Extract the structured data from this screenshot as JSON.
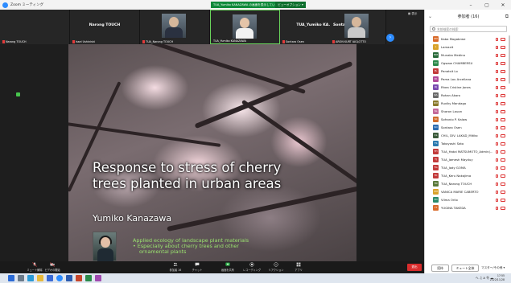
{
  "window": {
    "app_title": "Zoom ミーティング",
    "share_banner": "TUA_Yumiko KANAZAWA の画面を表示しています",
    "view_options_label": "ビューオプション ▾",
    "minimize": "–",
    "maximize": "▢",
    "close": "✕"
  },
  "video_strip": {
    "gallery_label": "▦ 表示",
    "next_icon": "›",
    "tiles": [
      {
        "center_name": "",
        "bottom_name": "Narong TOUCH",
        "photo": false
      },
      {
        "center_name": "Narong TOUCH",
        "bottom_name": "Issei Ushinishi",
        "photo": false
      },
      {
        "center_name": "",
        "bottom_name": "TUA_Narong TOUCH",
        "photo": true
      },
      {
        "center_name": "",
        "bottom_name": "TUA_Yumiko KANAZAWA",
        "photo": true
      },
      {
        "center_name": "TUA_Yumiko KA...",
        "bottom_name": "Sontaro Osen",
        "photo": false
      },
      {
        "center_name": "Sontaro Osen",
        "bottom_name": "ARON KURT IAGLOTTO",
        "photo": true
      }
    ]
  },
  "slide": {
    "title_line1": "Response to stress of cherry",
    "title_line2": "trees planted in urban areas",
    "author": "Yumiko Kanazawa",
    "bullet1": "Applied ecology of landscape plant materials",
    "bullet2": "• Especially about cherry trees and other",
    "bullet3": "ornamental plants"
  },
  "toolbar": {
    "items": [
      {
        "label": "ミュート解除",
        "icon": "microphone-icon"
      },
      {
        "label": "ビデオの開始",
        "icon": "video-camera-icon"
      },
      {
        "label": "参加者",
        "icon": "participants-icon",
        "count": "16"
      },
      {
        "label": "チャット",
        "icon": "chat-icon"
      },
      {
        "label": "画面を共有",
        "icon": "share-screen-icon"
      },
      {
        "label": "レコーディング",
        "icon": "record-icon"
      },
      {
        "label": "リアクション",
        "icon": "reaction-icon"
      },
      {
        "label": "アプリ",
        "icon": "apps-icon"
      }
    ],
    "end_label": "退出"
  },
  "sidebar": {
    "title": "参加者 (16)",
    "search_placeholder": "名前検索の検索",
    "invite_label": "招待",
    "unmute_all_label": "ミュート全体",
    "more_label": "マスター/その他 ▾",
    "participants": [
      {
        "name": "Kaba Mogabrwe",
        "initials": "KM",
        "color": "#d96b2b"
      },
      {
        "name": "Lamaxit",
        "initials": "L",
        "color": "#d9a32b"
      },
      {
        "name": "Munaka Medina",
        "initials": "MM",
        "color": "#2a6b3a"
      },
      {
        "name": "Ogwaw CHAMBERSU",
        "initials": "OC",
        "color": "#2b8a4a"
      },
      {
        "name": "Panatsit Lo",
        "initials": "PL",
        "color": "#c23b3b"
      },
      {
        "name": "Pama Lou Arcellana",
        "initials": "PA",
        "color": "#b04a9a"
      },
      {
        "name": "Rhea Cristine Jones",
        "initials": "RJ",
        "color": "#7a4ab0"
      },
      {
        "name": "Rohan Akaro",
        "initials": "RA",
        "color": "#6b6b6b"
      },
      {
        "name": "Ruvlky Mandago",
        "initials": "RM",
        "color": "#8a7a2b"
      },
      {
        "name": "Sharon Lauon",
        "initials": "SL",
        "color": "#c46a9a"
      },
      {
        "name": "Sofronio P. Kalaw",
        "initials": "SK",
        "color": "#d06b2b"
      },
      {
        "name": "Sontaro Osen",
        "initials": "SO",
        "color": "#2b6bb0"
      },
      {
        "name": "CHIL, DIV. LAKAD_Mitiko",
        "initials": "CL",
        "color": "#3b5b3b"
      },
      {
        "name": "Takayoshi Sato",
        "initials": "TS",
        "color": "#2b7ab0"
      },
      {
        "name": "TUA_Hatai MATSUMOTO_Admin(...)",
        "initials": "TH",
        "color": "#c23b3b"
      },
      {
        "name": "TUA_Jamesh Mayduy",
        "initials": "TJ",
        "color": "#c23b3b"
      },
      {
        "name": "TUA_Jody GOMA",
        "initials": "TG",
        "color": "#c23b3b"
      },
      {
        "name": "TUA_Keru Nakajima",
        "initials": "TK",
        "color": "#c23b3b"
      },
      {
        "name": "TUA_Narong TOUCH",
        "initials": "TN",
        "color": "#5a7a3a"
      },
      {
        "name": "VANICA MARIE CABERTO",
        "initials": "VM",
        "color": "#d9a32b"
      },
      {
        "name": "Vilma Orilo",
        "initials": "VO",
        "color": "#2b8a6a"
      },
      {
        "name": "YUGINA TAKEDA",
        "initials": "YT",
        "color": "#d96b2b"
      }
    ]
  },
  "taskbar": {
    "tray_text": "へ ♫ A 令 ☁",
    "time": "17:55",
    "date": "2022/11/28"
  },
  "colors": {
    "zoom_blue": "#2d8cff",
    "share_green": "#0f8a3a",
    "end_red": "#d92d2d",
    "slide_green_text": "#9be36f"
  }
}
